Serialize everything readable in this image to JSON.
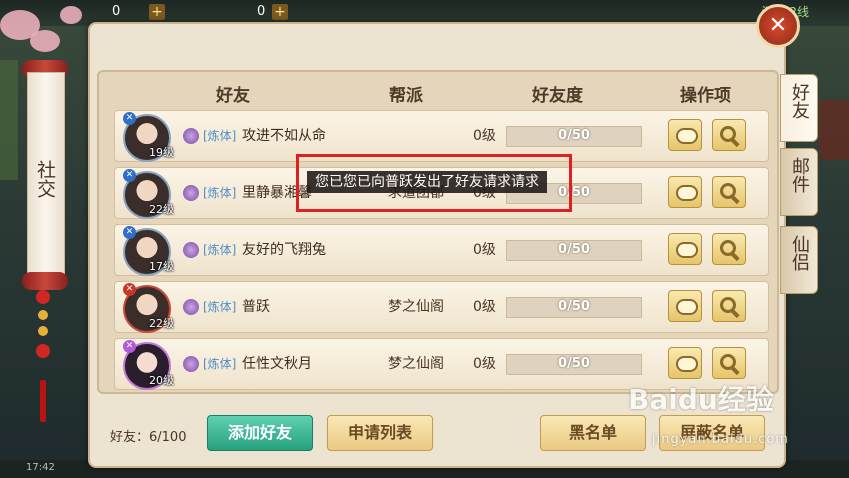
{
  "hud": {
    "currency1": "0",
    "currency2": "0",
    "place": "溪村 2线",
    "status_bar": "17:42"
  },
  "side_scroll": {
    "label": "社交"
  },
  "tabs": [
    {
      "label": "好友",
      "active": true
    },
    {
      "label": "邮件",
      "active": false
    },
    {
      "label": "仙侣",
      "active": false
    }
  ],
  "columns": {
    "friend": "好友",
    "guild": "帮派",
    "affinity": "好友度",
    "actions": "操作项"
  },
  "rows": [
    {
      "level": "19级",
      "tag": "[炼体]",
      "name": "攻进不如从命",
      "guild": "",
      "affinity_level": "0级",
      "affinity_progress": "0/50",
      "class_color": "blue"
    },
    {
      "level": "22级",
      "tag": "[炼体]",
      "name": "里静暴湘馨",
      "guild": "求道团都",
      "affinity_level": "0级",
      "affinity_progress": "0/50",
      "class_color": "blue"
    },
    {
      "level": "17级",
      "tag": "[炼体]",
      "name": "友好的飞翔兔",
      "guild": "",
      "affinity_level": "0级",
      "affinity_progress": "0/50",
      "class_color": "blue"
    },
    {
      "level": "22级",
      "tag": "[炼体]",
      "name": "普跃",
      "guild": "梦之仙阁",
      "affinity_level": "0级",
      "affinity_progress": "0/50",
      "class_color": "red"
    },
    {
      "level": "20级",
      "tag": "[炼体]",
      "name": "任性文秋月",
      "guild": "梦之仙阁",
      "affinity_level": "0级",
      "affinity_progress": "0/50",
      "class_color": "pink"
    }
  ],
  "popup": {
    "message": "您已您已向普跃发出了好友请求请求"
  },
  "footer": {
    "friend_count": "好友：6/100",
    "add_friend": "添加好友",
    "request_list": "申请列表",
    "blacklist": "黑名单",
    "block_list": "屏蔽名单"
  },
  "close_label": "✕",
  "watermark": {
    "brand": "Baidu经验",
    "url": "jingyan.baidu.com"
  },
  "colors": {
    "accent_green": "#27a07e",
    "highlight_red": "#e02020",
    "panel_bg": "#ede3d1"
  }
}
